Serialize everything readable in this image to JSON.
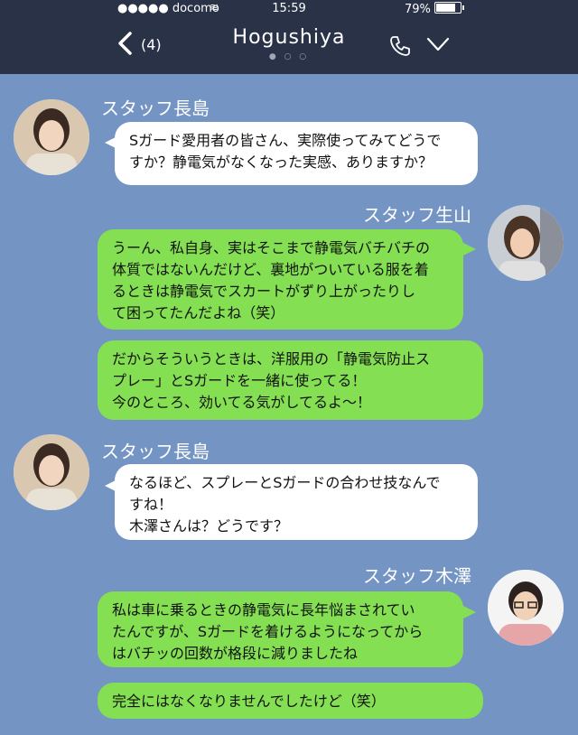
{
  "status_bar": {
    "carrier": "●●●●● docomo",
    "time": "15:59",
    "battery": "79%"
  },
  "header": {
    "back_count": "(4)",
    "title": "Hogushiya",
    "page_dots": "● ○ ○"
  },
  "messages": [
    {
      "speaker": "スタッフ長島",
      "side": "left",
      "lines": [
        "Sガード愛用者の皆さん、実際使ってみてどうで",
        "すか？静電気がなくなった実感、ありますか？"
      ]
    },
    {
      "speaker": "スタッフ生山",
      "side": "right",
      "lines": [
        "うーん、私自身、実はそこまで静電気バチバチの",
        "体質ではないんだけど、裏地がついている服を着",
        "るときは静電気でスカートがずり上がったりし",
        "て困ってたんだよね（笑）"
      ]
    },
    {
      "speaker": "",
      "side": "right",
      "lines": [
        "だからそういうときは、洋服用の「静電気防止ス",
        "プレー」とSガードを一緒に使ってる！",
        "今のところ、効いてる気がしてるよ～！"
      ]
    },
    {
      "speaker": "スタッフ長島",
      "side": "left",
      "lines": [
        "なるほど、スプレーとSガードの合わせ技なんで",
        "すね！",
        "木澤さんは？どうです？"
      ]
    },
    {
      "speaker": "スタッフ木澤",
      "side": "right",
      "lines": [
        "私は車に乗るときの静電気に長年悩まされてい",
        "たんですが、Sガードを着けるようになってから",
        "はバチッの回数が格段に減りましたね"
      ]
    },
    {
      "speaker": "",
      "side": "right",
      "lines": [
        "完全にはなくなりませんでしたけど（笑）"
      ]
    }
  ],
  "colors": {
    "background": "#7494c4",
    "header": "#293247",
    "green_bubble": "#84e052",
    "white_bubble": "#ffffff"
  },
  "icons": [
    "back-chevron-icon",
    "phone-icon",
    "dropdown-chevron-icon",
    "wifi-icon",
    "battery-icon"
  ]
}
